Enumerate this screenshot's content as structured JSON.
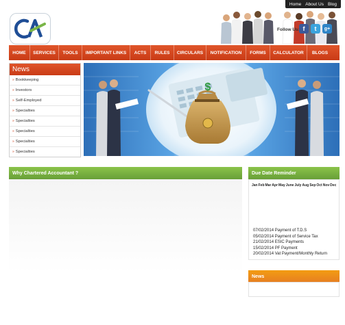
{
  "top_links": [
    "Home",
    "About Us",
    "Blog"
  ],
  "logo": {
    "text": "CA"
  },
  "follow_us": "Follow Us:",
  "social": [
    {
      "name": "facebook",
      "glyph": "f",
      "color": "#3b5998"
    },
    {
      "name": "twitter",
      "glyph": "t",
      "color": "#3aa3dd"
    },
    {
      "name": "googleplus",
      "glyph": "g+",
      "color": "#2f85c8"
    }
  ],
  "nav": [
    "HOME",
    "SERVICES",
    "TOOLS",
    "IMPORTANT LINKS",
    "ACTS",
    "RULES",
    "CIRCULARS",
    "NOTIFICATION",
    "FORMS",
    "CALCULATOR",
    "BLOGS"
  ],
  "news_sidebar": {
    "title": "News",
    "items": [
      "Bookkeeping",
      "Investors",
      "Self-Employed",
      "Specialties",
      "Specialties",
      "Specialties",
      "Specialties",
      "Specialties"
    ]
  },
  "why_section": {
    "title": "Why Chartered Accountant ?"
  },
  "due_date": {
    "title": "Due Date Reminder",
    "months": [
      "Jan",
      "Feb",
      "Mar",
      "Apr",
      "May",
      "June",
      "July",
      "Aug",
      "Sep",
      "Oct",
      "Nov",
      "Dec"
    ],
    "entries": [
      "07/02/2014 Payment of T.D.S",
      "05/02/2014 Payment of Service Tax",
      "21/02/2014 ESIC Payments",
      "15/02/2014 PF Payment",
      "20/02/2014 Vat Payment/Monthly Return"
    ]
  },
  "news_section": {
    "title": "News"
  },
  "colors": {
    "nav": "#c93b16",
    "green_bar": "#7cb342",
    "orange_bar": "#ef8c1c"
  }
}
